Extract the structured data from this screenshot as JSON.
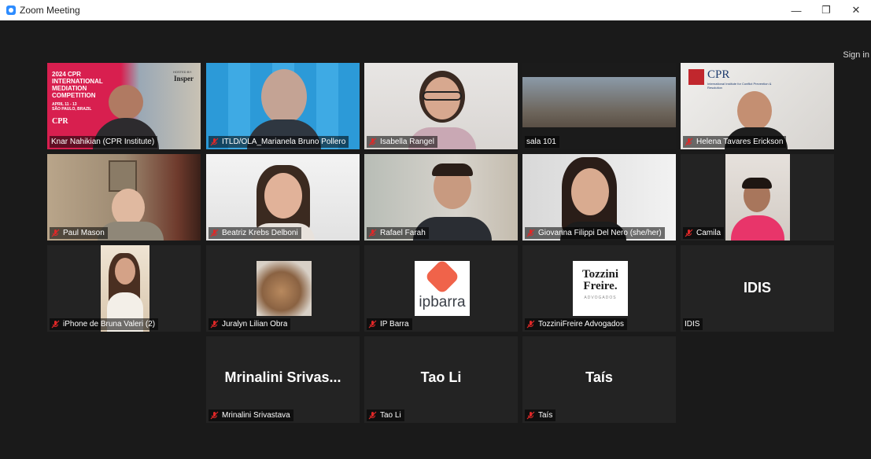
{
  "window": {
    "title": "Zoom Meeting",
    "sign_in": "Sign in"
  },
  "participants": [
    {
      "name": "Knar Nahikian (CPR Institute)",
      "muted": false,
      "active": true
    },
    {
      "name": "ITLD/OLA_Marianela Bruno Pollero",
      "muted": true
    },
    {
      "name": "Isabella Rangel",
      "muted": true
    },
    {
      "name": "sala 101",
      "muted": false
    },
    {
      "name": "Helena Tavares Erickson",
      "muted": true
    },
    {
      "name": "Paul Mason",
      "muted": true
    },
    {
      "name": "Beatriz Krebs Delboni",
      "muted": true
    },
    {
      "name": "Rafael Farah",
      "muted": true
    },
    {
      "name": "Giovanna Filippi Del Nero (she/her)",
      "muted": true
    },
    {
      "name": "Camila",
      "muted": true
    },
    {
      "name": "iPhone de Bruna Valeri (2)",
      "muted": true
    },
    {
      "name": "Juralyn Lilian Obra",
      "muted": true
    },
    {
      "name": "IP Barra",
      "muted": true
    },
    {
      "name": "TozziniFreire Advogados",
      "muted": true
    },
    {
      "name": "IDIS",
      "muted": false,
      "display": "IDIS"
    },
    {
      "name": "Mrinalini Srivastava",
      "muted": true,
      "display": "Mrinalini Srivas..."
    },
    {
      "name": "Tao Li",
      "muted": true,
      "display": "Tao Li"
    },
    {
      "name": "Taís",
      "muted": true,
      "display": "Taís"
    }
  ],
  "banner": {
    "year_title": "2024 CPR",
    "line2": "INTERNATIONAL",
    "line3": "MEDIATION",
    "line4": "COMPETITION",
    "dates": "APRIL 11 - 13",
    "city": "SÃO PAULO, BRAZIL",
    "hosted_by": "HOSTED BY:",
    "host": "Insper",
    "org": "CPR"
  },
  "logos": {
    "ipbarra": "ipbarra",
    "tozzini_line1": "Tozzini",
    "tozzini_line2": "Freire.",
    "tozzini_sub": "ADVOGADOS",
    "cpr": "CPR",
    "cpr_sub": "International Institute for Conflict Prevention & Resolution"
  },
  "colors": {
    "active_border": "#e5e86a",
    "mute_red": "#e02828",
    "zoom_blue": "#2d8cff"
  }
}
